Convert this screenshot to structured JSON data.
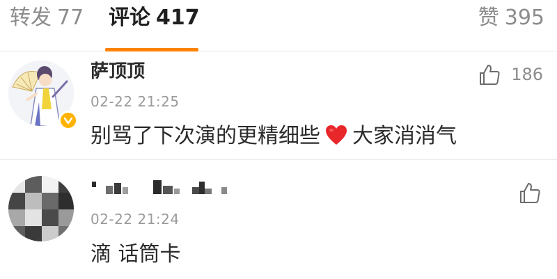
{
  "tabs": {
    "repost": {
      "label": "转发",
      "count": "77"
    },
    "comments": {
      "label": "评论",
      "count": "417"
    },
    "likes": {
      "label": "赞",
      "count": "395"
    },
    "active_color": "#ff8200"
  },
  "comments": [
    {
      "username": "萨顶顶",
      "verified": true,
      "timestamp": "02-22 21:25",
      "text_before": "别骂了下次演的更精细些",
      "emoji": "heart-icon",
      "text_after": "大家消消气",
      "like_count": "186"
    },
    {
      "username_obscured": true,
      "timestamp": "02-22 21:24",
      "text": "滴 话筒卡",
      "like_count": ""
    }
  ],
  "colors": {
    "badge": "#ffb300",
    "heart": "#e8272b",
    "secondary_text": "#8c8c8c"
  }
}
